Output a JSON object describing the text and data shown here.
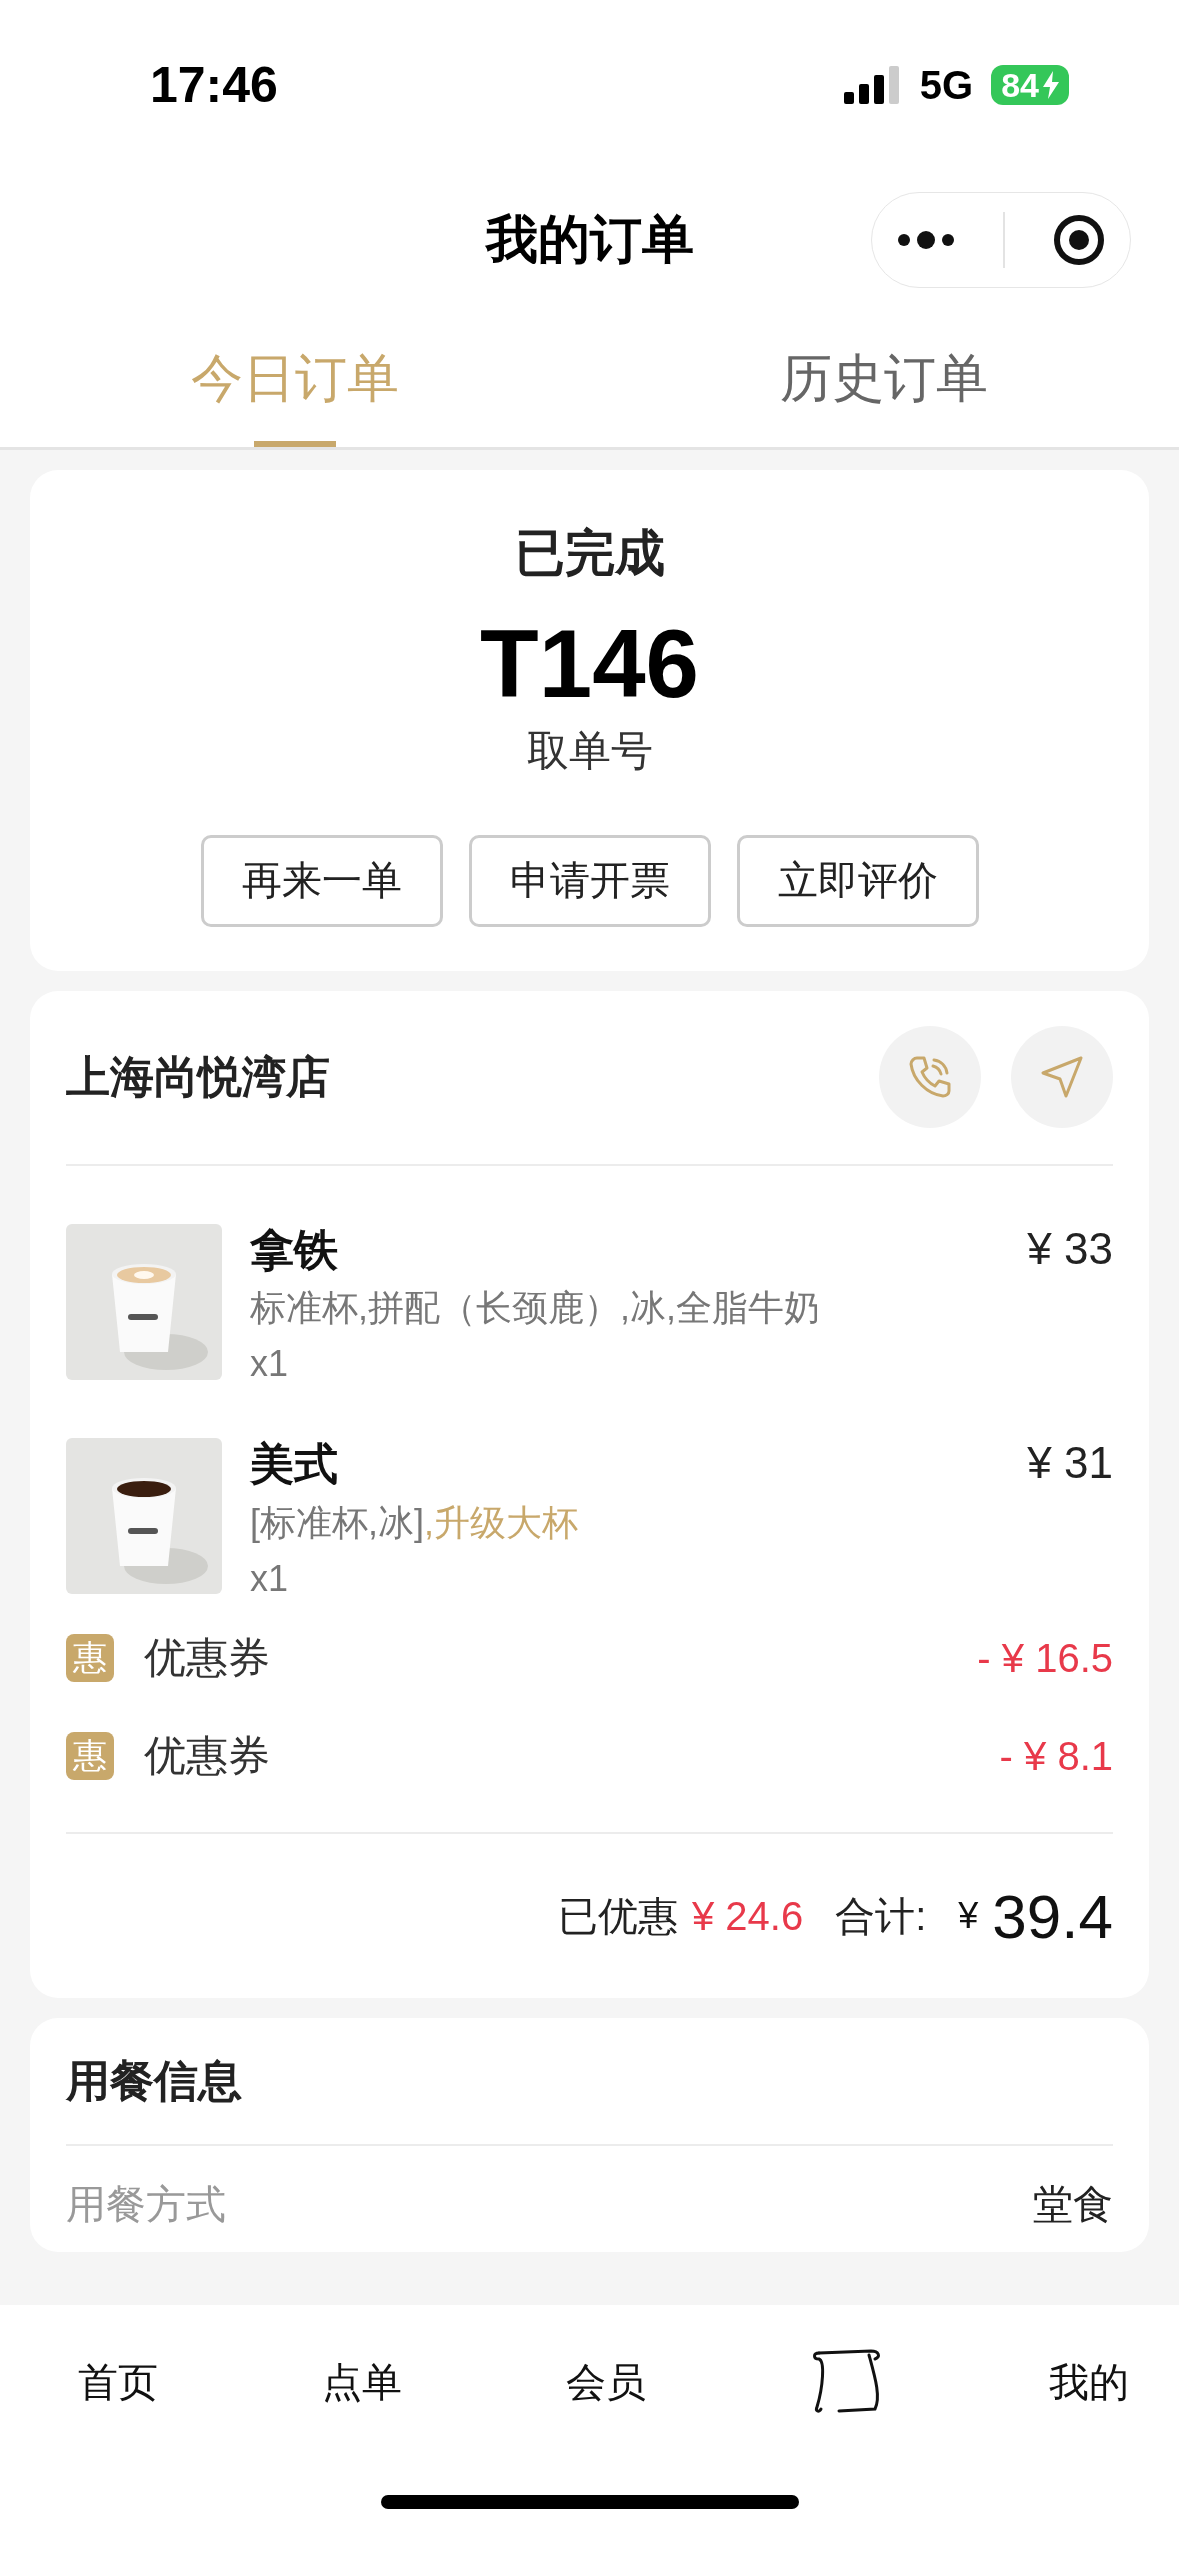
{
  "status_bar": {
    "time": "17:46",
    "network": "5G",
    "battery": "84"
  },
  "nav": {
    "title": "我的订单"
  },
  "tabs": [
    {
      "label": "今日订单",
      "selected": true
    },
    {
      "label": "历史订单",
      "selected": false
    }
  ],
  "status_card": {
    "status": "已完成",
    "pickup_number": "T146",
    "pickup_label": "取单号",
    "buttons": [
      "再来一单",
      "申请开票",
      "立即评价"
    ]
  },
  "order": {
    "store_name": "上海尚悦湾店",
    "items": [
      {
        "name": "拿铁",
        "options": [
          {
            "text": "标准杯,拼配（长颈鹿）,冰,全脂牛奶",
            "highlighted": false
          }
        ],
        "quantity": "x1",
        "price": "¥ 33"
      },
      {
        "name": "美式",
        "options": [
          {
            "text": "[标准杯,冰]",
            "highlighted": false
          },
          {
            "text": ",升级大杯",
            "highlighted": true
          }
        ],
        "quantity": "x1",
        "price": "¥ 31"
      }
    ],
    "discounts": [
      {
        "badge": "惠",
        "label": "优惠券",
        "amount": "- ¥ 16.5"
      },
      {
        "badge": "惠",
        "label": "优惠券",
        "amount": "- ¥ 8.1"
      }
    ],
    "summary": {
      "saved_label": "已优惠",
      "saved_amount": "¥ 24.6",
      "total_label": "合计:",
      "currency": "¥",
      "total": "39.4"
    }
  },
  "dining": {
    "title": "用餐信息",
    "rows": [
      {
        "label": "用餐方式",
        "value": "堂食"
      }
    ]
  },
  "tab_bar": [
    {
      "kind": "text",
      "label": "首页"
    },
    {
      "kind": "text",
      "label": "点单"
    },
    {
      "kind": "text",
      "label": "会员"
    },
    {
      "kind": "icon"
    },
    {
      "kind": "text",
      "label": "我的"
    }
  ]
}
